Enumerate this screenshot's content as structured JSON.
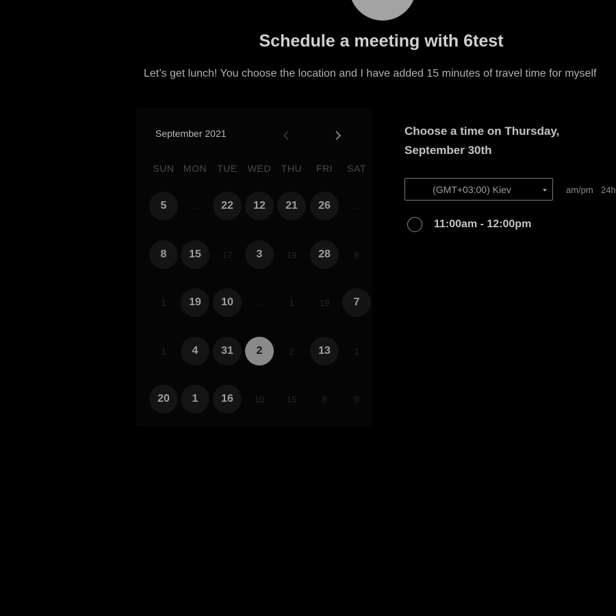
{
  "header": {
    "title": "Schedule a meeting with 6test",
    "description": "Let’s get lunch! You choose the location and I have added 15 minutes of travel time for myself"
  },
  "calendar": {
    "month_label": "September 2021",
    "prev_icon": "chevron-left-icon",
    "next_icon": "chevron-right-icon",
    "weekdays": [
      "SUN",
      "MON",
      "TUE",
      "WED",
      "THU",
      "FRI",
      "SAT"
    ],
    "rows": [
      [
        {
          "label": "5",
          "available": true
        },
        {
          "label": "...",
          "available": false
        },
        {
          "label": "22",
          "available": true
        },
        {
          "label": "12",
          "available": true
        },
        {
          "label": "21",
          "available": true
        },
        {
          "label": "26",
          "available": true
        },
        {
          "label": "...",
          "available": false
        }
      ],
      [
        {
          "label": "8",
          "available": true
        },
        {
          "label": "15",
          "available": true
        },
        {
          "label": "17",
          "available": false
        },
        {
          "label": "3",
          "available": true
        },
        {
          "label": "19",
          "available": false
        },
        {
          "label": "28",
          "available": true
        },
        {
          "label": "9",
          "available": false
        }
      ],
      [
        {
          "label": "1",
          "available": false
        },
        {
          "label": "19",
          "available": true
        },
        {
          "label": "10",
          "available": true
        },
        {
          "label": "...",
          "available": false
        },
        {
          "label": "1",
          "available": false
        },
        {
          "label": "19",
          "available": false
        },
        {
          "label": "7",
          "available": true
        }
      ],
      [
        {
          "label": "1",
          "available": false
        },
        {
          "label": "4",
          "available": true
        },
        {
          "label": "31",
          "available": true
        },
        {
          "label": "2",
          "available": true,
          "selected": true
        },
        {
          "label": "2",
          "available": false
        },
        {
          "label": "13",
          "available": true
        },
        {
          "label": "1",
          "available": false
        }
      ],
      [
        {
          "label": "20",
          "available": true
        },
        {
          "label": "1",
          "available": true
        },
        {
          "label": "16",
          "available": true
        },
        {
          "label": "10",
          "available": false
        },
        {
          "label": "15",
          "available": false
        },
        {
          "label": "8",
          "available": false
        },
        {
          "label": "9",
          "available": false
        }
      ]
    ]
  },
  "times": {
    "title": "Choose a time on Thursday, September 30th",
    "timezone": "(GMT+03:00) Kiev",
    "format_ampm": "am/pm",
    "format_24h": "24h",
    "slots": [
      "11:00am - 12:00pm"
    ]
  },
  "colors": {
    "background": "#000000",
    "selected_day": "#8a8a8a",
    "available_day": "#141414"
  }
}
